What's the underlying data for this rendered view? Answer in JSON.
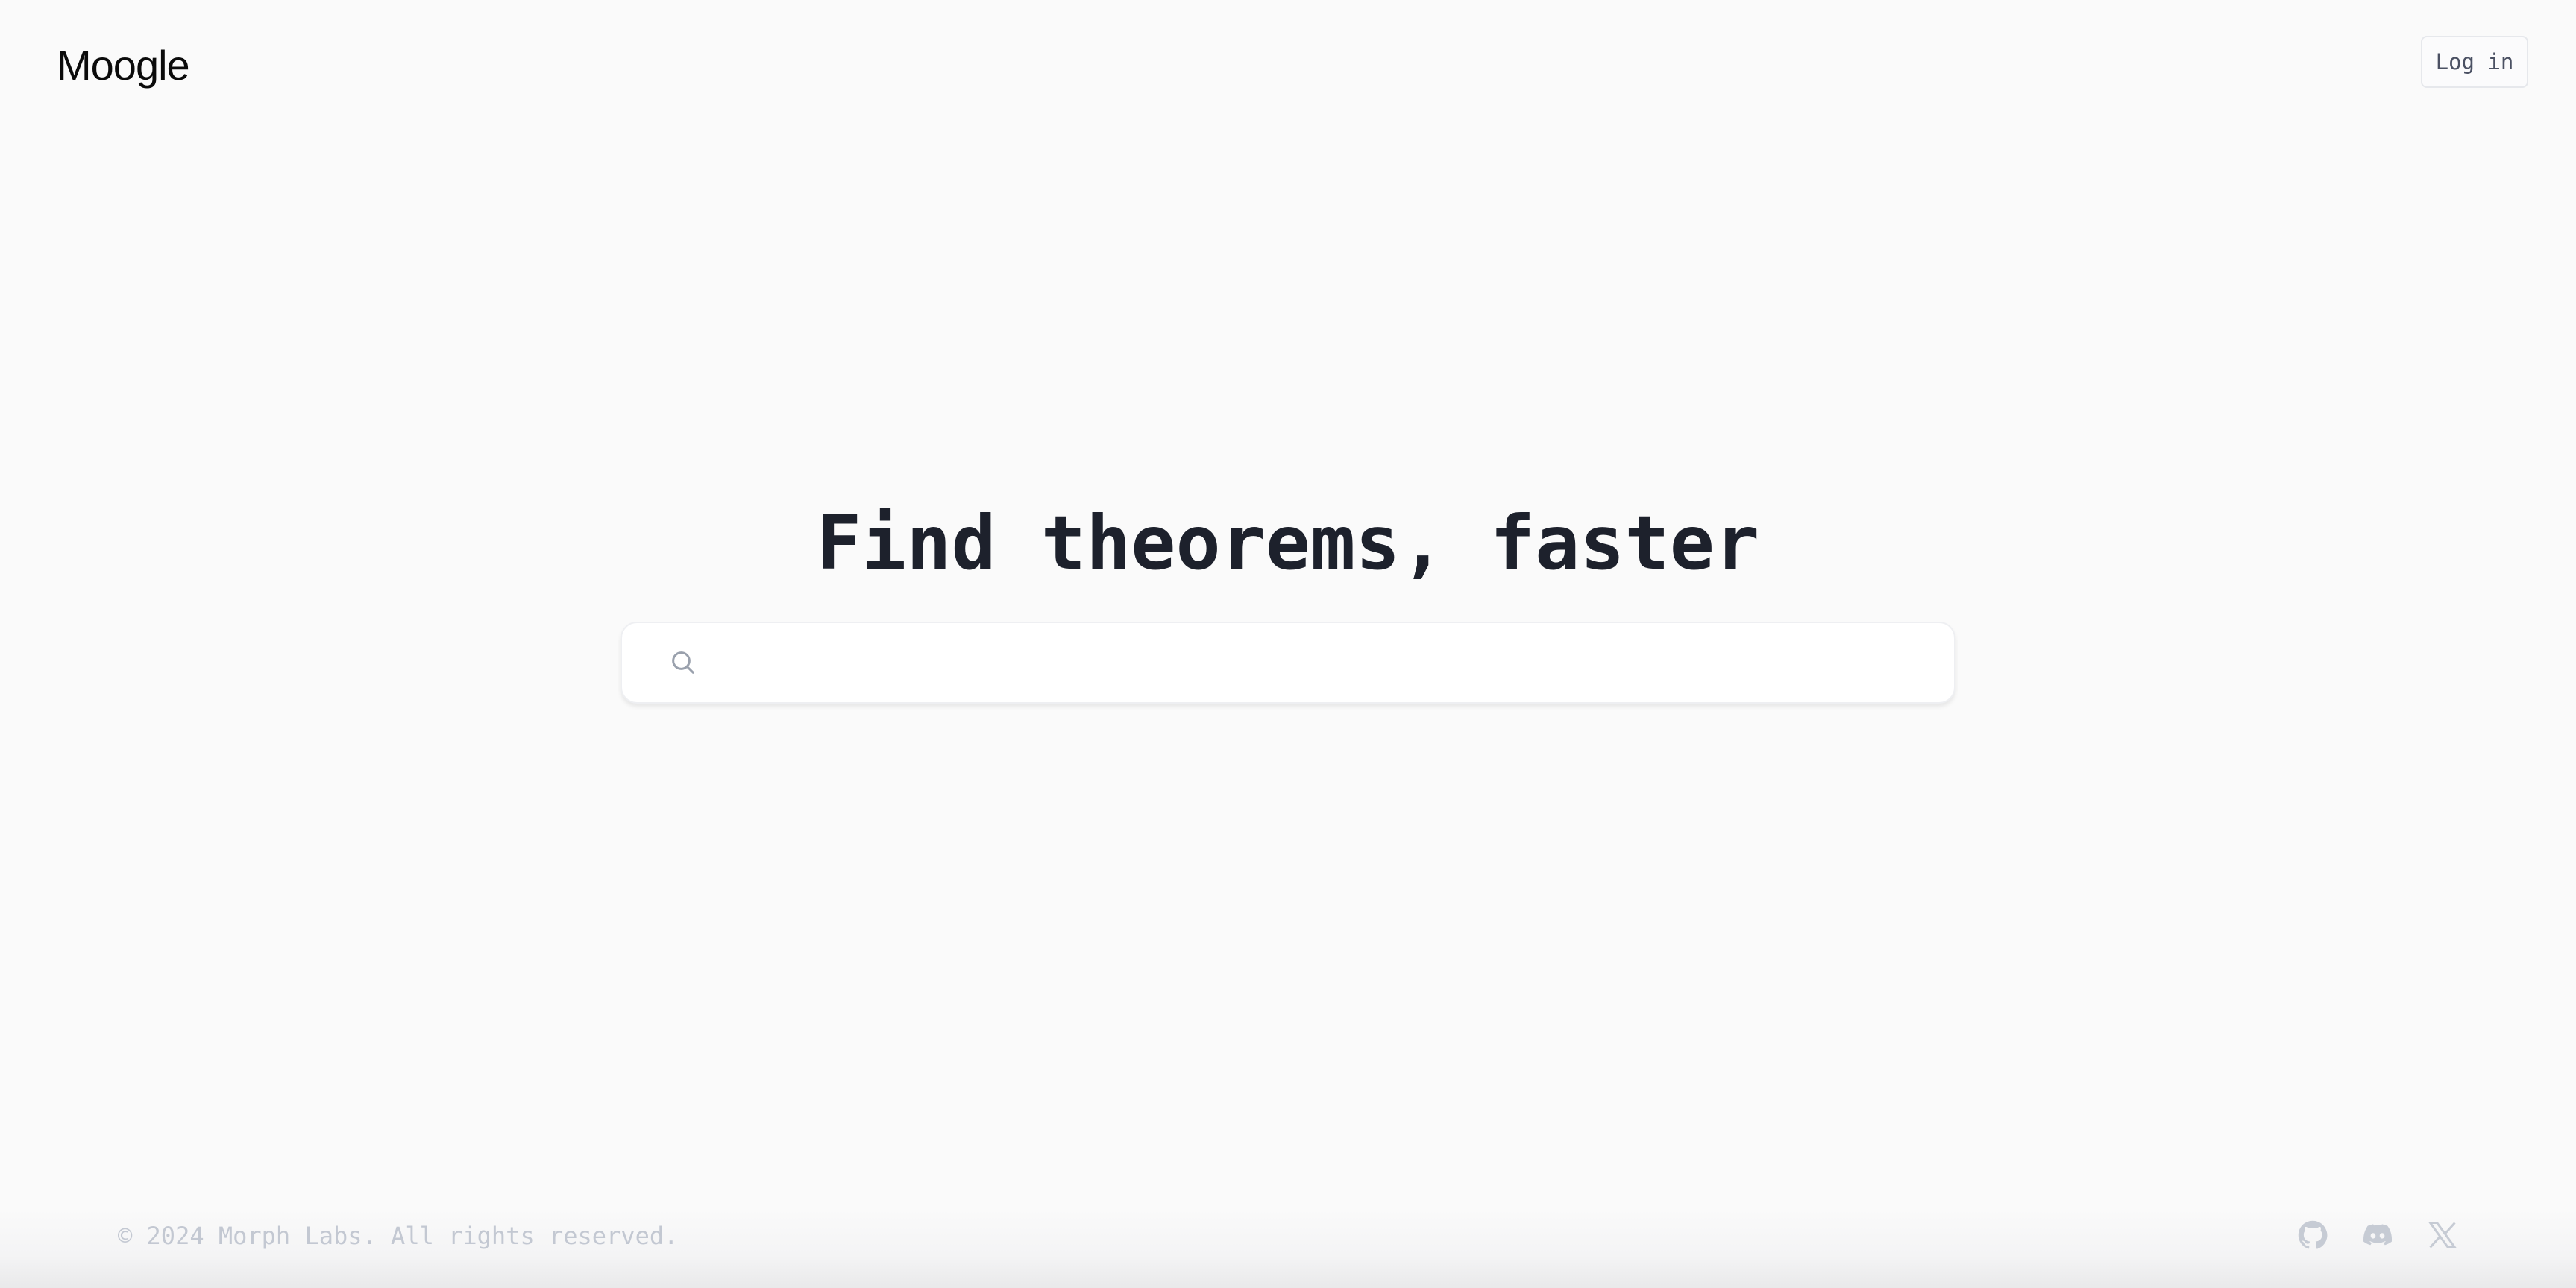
{
  "header": {
    "logo_text": "Moogle",
    "login_label": "Log in"
  },
  "hero": {
    "title": "Find theorems, faster"
  },
  "search": {
    "icon": "search-icon",
    "value": "",
    "placeholder": ""
  },
  "footer": {
    "copyright": "© 2024 Morph Labs. All rights reserved.",
    "social_icons": [
      "github-icon",
      "discord-icon",
      "x-icon"
    ]
  },
  "colors": {
    "background": "#fafafa",
    "title": "#1d212c",
    "muted": "#c3c8d2",
    "icon": "#c6cbd4"
  }
}
